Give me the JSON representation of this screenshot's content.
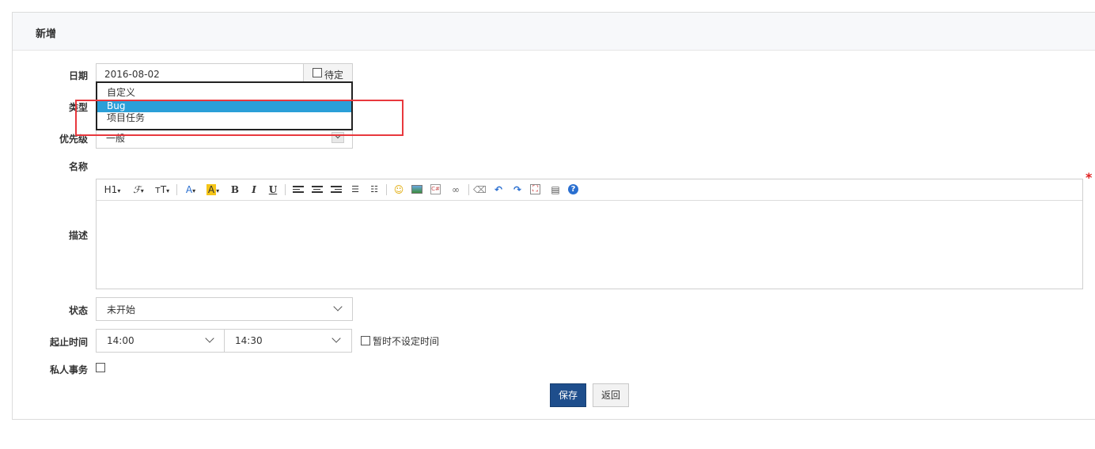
{
  "form": {
    "title": "新增",
    "date": {
      "label": "日期",
      "value": "2016-08-02",
      "pending_label": "待定"
    },
    "type": {
      "label": "类型",
      "options": [
        "自定义",
        "Bug",
        "项目任务"
      ],
      "selected": "Bug"
    },
    "priority": {
      "label": "优先级",
      "value": "一般"
    },
    "name": {
      "label": "名称"
    },
    "description": {
      "label": "描述"
    },
    "status": {
      "label": "状态",
      "value": "未开始"
    },
    "time": {
      "label": "起止时间",
      "start": "14:00",
      "end": "14:30",
      "no_time_label": "暂时不设定时间"
    },
    "private": {
      "label": "私人事务"
    },
    "required_mark": "*"
  },
  "editor_toolbar": {
    "heading": "H1",
    "font": "ℱ",
    "size": "тT",
    "font_color": "A",
    "highlight": "A",
    "bold": "B",
    "italic": "I",
    "underline": "U"
  },
  "buttons": {
    "save": "保存",
    "back": "返回"
  },
  "colors": {
    "accent": "#2a9fd8",
    "save_button": "#1e4e8c",
    "highlight_box": "#e8383d",
    "required": "#e02020"
  }
}
